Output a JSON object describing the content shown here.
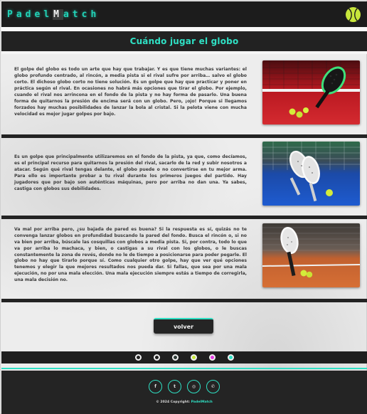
{
  "header": {
    "logo_part1": "Padel",
    "logo_mid": "M",
    "logo_part2": "atch",
    "ball_icon": "tennis-ball-icon"
  },
  "title": "Cuándo jugar el globo",
  "sections": [
    {
      "text": "El golpe del globo es todo un arte que hay que trabajar. Y es que tiene muchas variantes: el globo profundo centrado, al rincón, a media pista si el rival sufre por arriba… salvo el globo corto. El dichoso globo corto no tiene solución. Es un golpe que hay que practicar y poner en práctica según el rival. En ocasiones no habrá más opciones que tirar el globo. Por ejemplo, cuando el rival nos arrinconа en el fondo de la pista y no hay forma de pasarlo. Una buena forma de quitarnos la presión de encima será con un globo. Pero, ¡ojo! Porque si llegamos forzados hay muchas posibilidades de lanzar la bola al cristal. Si la pelota viene con mucha velocidad es mejor jugar golpes por bajo.",
      "image": "padel-racket-red-court-image"
    },
    {
      "text": "Es un golpe que principalmente utilizaremos en el fondo de la pista, ya que, como decíamos, es el principal recurso para quitarnos la presión del rival, sacarlo de la red y subir nosotros a atacar. Según qué rival tengas delante, el globo puede o no convertirse en tu mejor arma. Para ello es importante probar a tu rival durante los primeros juegos del partido. Hay jugadores que por bajo son auténticas máquinas, pero por arriba no dan una. Ya sabes, castiga con globos sus debilidades.",
      "image": "padel-rackets-blue-court-image"
    },
    {
      "text": "Va mal por arriba pero, ¿su bajada de pared es buena? Si la respuesta es sí, quizás no te convenga lanzar globos en profundidad buscando la pared del fondo. Busca el rincón o, si no va bien por arriba, búscale las cosquillas con globos a media pista. Si, por contra, todo lo que va por arriba lo machaca, y bien, o castigas a su rival con los globos, o le buscas constantemente la zona de revés, donde no le de tiempo a posicionarse para poder pegarle. El globo no hay que tirarlo porque sí. Como cualquier otro golpe, hay que ver qué opciones tenemos y elegir la que mejores resultados nos pueda dar. Si fallas, que sea por una mala ejecución, no por una mala elección. Una mala ejecución siempre estás a tiempo de corregirla, una mala decisión no.",
      "image": "padel-racket-clay-court-image"
    }
  ],
  "back_button": "volver",
  "dots": [
    {
      "color": "#1f1f1f"
    },
    {
      "color": "#1f1f1f"
    },
    {
      "color": "#2e3b36"
    },
    {
      "color": "#c6e83a"
    },
    {
      "color": "#e23adf"
    },
    {
      "color": "#2fe0c4"
    }
  ],
  "footer": {
    "socials": [
      {
        "icon": "facebook-icon",
        "glyph": "f"
      },
      {
        "icon": "twitter-icon",
        "glyph": "t"
      },
      {
        "icon": "instagram-icon",
        "glyph": "◎"
      },
      {
        "icon": "whatsapp-icon",
        "glyph": "✆"
      }
    ],
    "copyright_prefix": "© 2024 Copyright:",
    "copyright_brand": "PadelMatch"
  },
  "colors": {
    "accent": "#2fe0c4",
    "dark": "#1c1c1c",
    "ball": "#c7e63b"
  }
}
